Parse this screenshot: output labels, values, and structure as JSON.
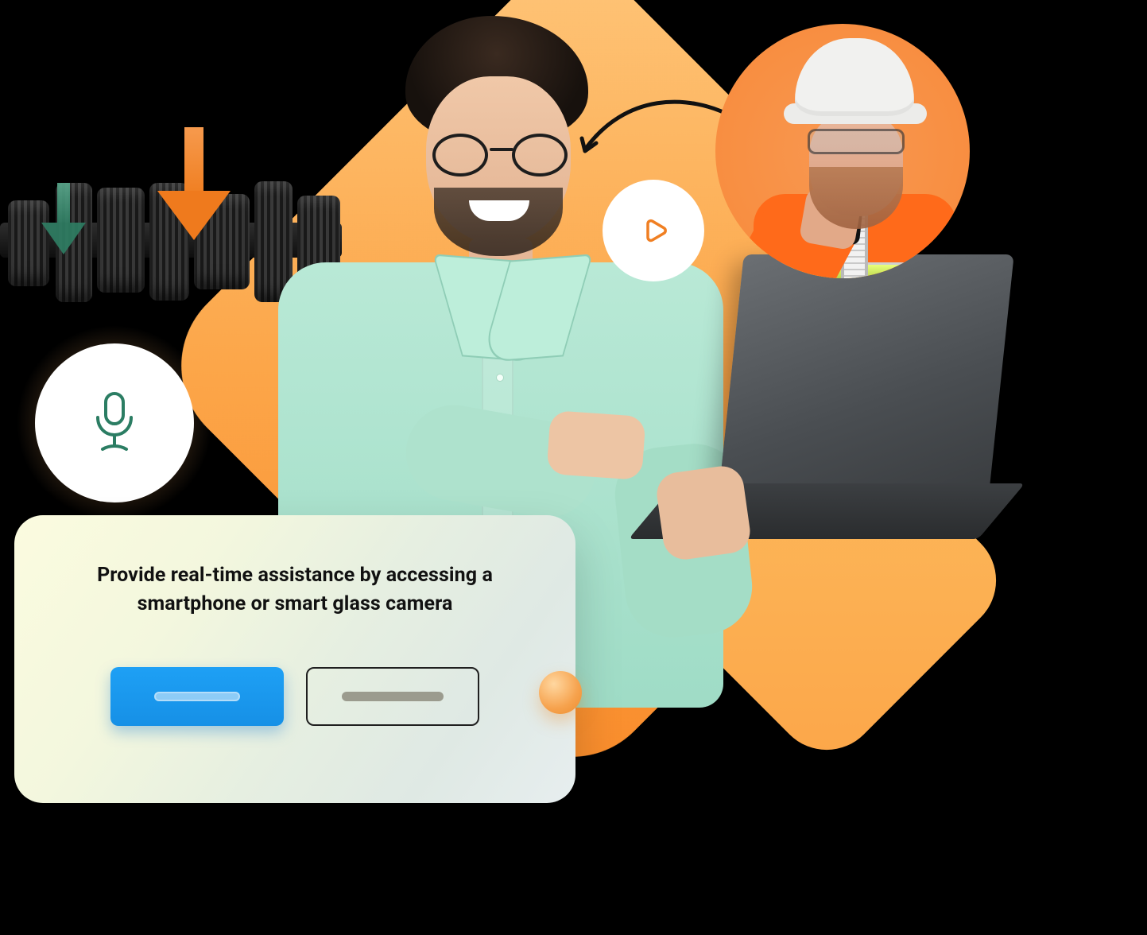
{
  "colors": {
    "orange_light": "#fdbb5d",
    "orange": "#f98b2a",
    "teal": "#2e7e63",
    "mint": "#b9e9d6",
    "blue": "#1ea0f5",
    "card_bg_start": "#fbfbdf",
    "card_bg_end": "#e7eeef"
  },
  "scene": {
    "main_subject": "expert-with-laptop",
    "secondary_subject": "field-worker-with-smartphone",
    "object": "mechanical-gear-shaft"
  },
  "icons": {
    "microphone": "microphone-icon",
    "play": "play-icon",
    "arrow_down_orange": "arrow-down-orange-icon",
    "arrow_down_green": "arrow-down-green-icon",
    "connector_arrow": "curved-connector-arrow-icon"
  },
  "card": {
    "text": "Provide real-time assistance by accessing a smartphone or smart glass camera",
    "primary_button_label": "",
    "secondary_button_label": ""
  }
}
